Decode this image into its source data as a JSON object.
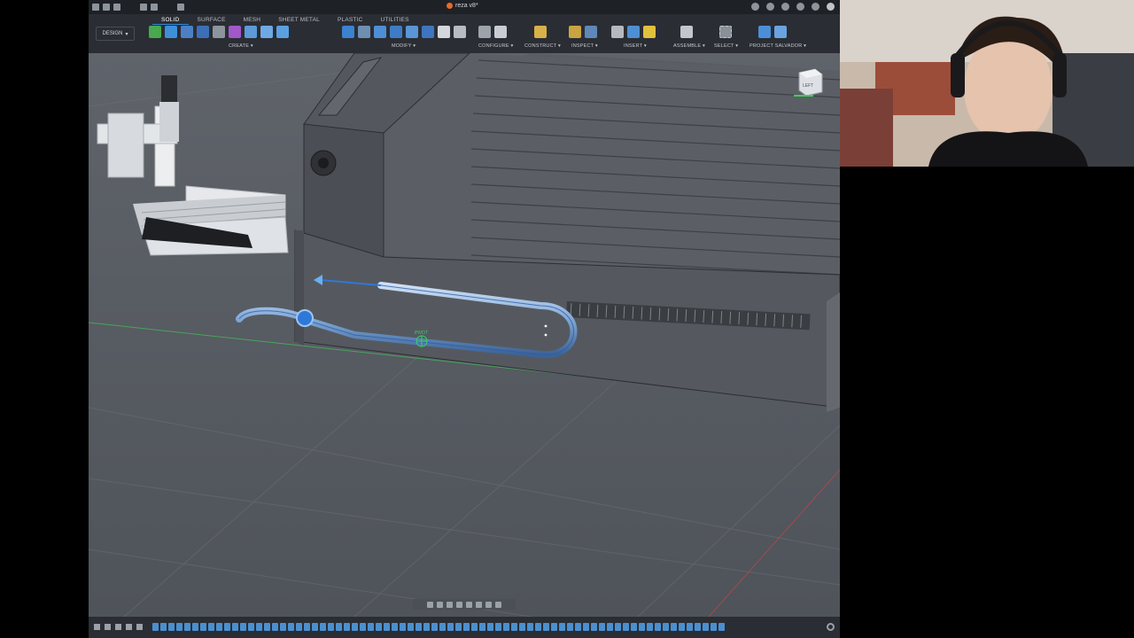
{
  "app": {
    "document_title": "reza v8*",
    "design_workspace": "DESIGN",
    "tabs": [
      "SOLID",
      "SURFACE",
      "MESH",
      "SHEET METAL",
      "PLASTIC",
      "UTILITIES"
    ],
    "active_tab": "SOLID",
    "groups": [
      "CREATE ▾",
      "MODIFY ▾",
      "CONFIGURE ▾",
      "CONSTRUCT ▾",
      "INSPECT ▾",
      "INSERT ▾",
      "ASSEMBLE ▾",
      "SELECT ▾",
      "PROJECT SALVADOR ▾"
    ]
  },
  "viewport": {
    "viewcube_face": "LEFT",
    "pivot_label": "PIVOT"
  },
  "colors": {
    "accent": "#2e8ad8",
    "toolbar_bg": "#2a2d33",
    "viewport_bg": "#5b5f66",
    "pivot_green": "#39d26a",
    "manipulator_blue": "#2f78d8"
  },
  "icons": {
    "file": "file-icon",
    "save": "save-icon",
    "undo": "undo-icon",
    "redo": "redo-icon",
    "home": "home-icon",
    "gear": "gear-icon",
    "bell": "bell-icon",
    "help": "help-icon",
    "orbit": "orbit-icon",
    "pan": "pan-icon",
    "zoom": "zoom-icon"
  }
}
